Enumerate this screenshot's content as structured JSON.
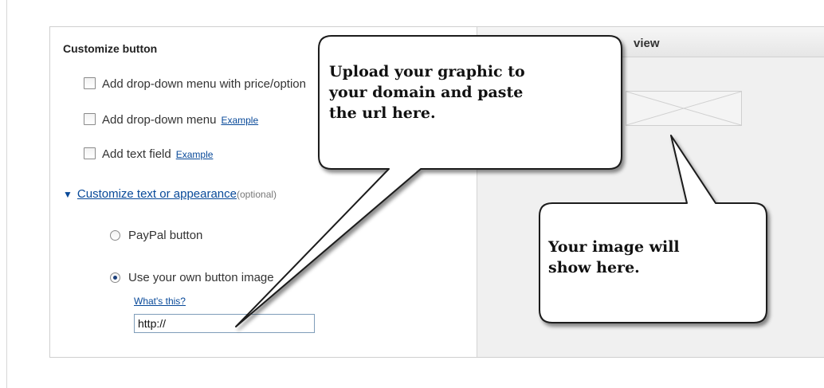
{
  "customize": {
    "title": "Customize button",
    "options": [
      {
        "label": "Add drop-down menu with price/option",
        "link": ""
      },
      {
        "label": "Add drop-down menu",
        "link": "Example"
      },
      {
        "label": "Add text field",
        "link": "Example"
      }
    ],
    "appearance_link": "Customize text or appearance",
    "appearance_optional": "(optional)",
    "radio_paypal": "PayPal button",
    "radio_own": "Use your own button image",
    "whats_this": "What's this?",
    "url_value": "http://"
  },
  "preview": {
    "title": "Your customized button preview"
  },
  "callouts": {
    "upload_lines": [
      "Upload your graphic to",
      "your domain and paste",
      "the url here."
    ],
    "image_lines": [
      "Your image will",
      "show here."
    ]
  }
}
